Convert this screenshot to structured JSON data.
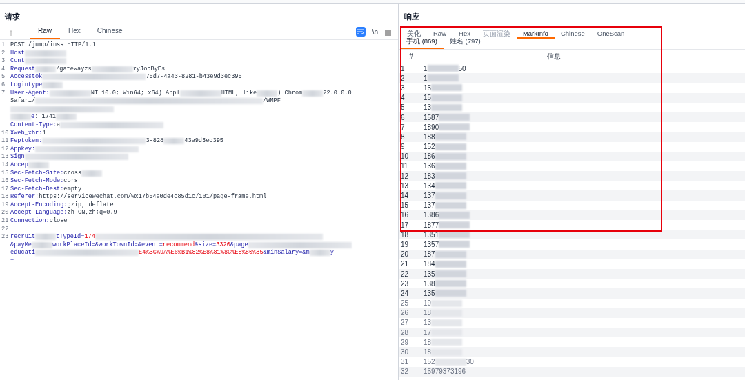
{
  "request": {
    "title": "请求",
    "tabs": [
      {
        "label": "Raw",
        "selected": true
      },
      {
        "label": "Hex",
        "selected": false
      },
      {
        "label": "Chinese",
        "selected": false
      }
    ],
    "toolbar": {
      "newline_label": "\\n",
      "wrap_on": true
    },
    "lines": [
      {
        "n": "1",
        "segments": [
          {
            "kind": "value",
            "t": "POST /jump/inss HTTP/1.1"
          }
        ]
      },
      {
        "n": "2",
        "segments": [
          {
            "kind": "name",
            "t": "Host"
          },
          {
            "kind": "blur_m"
          }
        ]
      },
      {
        "n": "3",
        "segments": [
          {
            "kind": "name",
            "t": "Cont"
          },
          {
            "kind": "blur_m"
          }
        ]
      },
      {
        "n": "4",
        "segments": [
          {
            "kind": "name",
            "t": "Request"
          },
          {
            "kind": "blur_s"
          },
          {
            "kind": "value",
            "t": "/gatewayzs"
          },
          {
            "kind": "blur_m"
          },
          {
            "kind": "value",
            "t": "ryJobByEs"
          }
        ]
      },
      {
        "n": "5",
        "segments": [
          {
            "kind": "name",
            "t": "Accesstok"
          },
          {
            "kind": "blur_l"
          },
          {
            "kind": "value",
            "t": "75d7-4a43-8281-b43e9d3ec395"
          }
        ]
      },
      {
        "n": "6",
        "segments": [
          {
            "kind": "name",
            "t": "Logintype"
          },
          {
            "kind": "blur_s"
          }
        ]
      },
      {
        "n": "7",
        "segments": [
          {
            "kind": "name",
            "t": "User-Agent:"
          },
          {
            "kind": "blur_m"
          },
          {
            "kind": "value",
            "t": "NT 10.0; Win64; x64) Appl"
          },
          {
            "kind": "blur_m"
          },
          {
            "kind": "value",
            "t": "HTML, like"
          },
          {
            "kind": "blur_s"
          },
          {
            "kind": "value",
            "t": ") Chrom"
          },
          {
            "kind": "blur_s"
          },
          {
            "kind": "value",
            "t": "22.0.0.0"
          }
        ]
      },
      {
        "segments": [
          {
            "kind": "value",
            "t": "Safari/"
          },
          {
            "kind": "blur_xl"
          },
          {
            "kind": "value",
            "t": "/WMPF"
          }
        ]
      },
      {
        "segments": [
          {
            "kind": "blur_l"
          }
        ]
      },
      {
        "segments": [
          {
            "kind": "blur_s"
          },
          {
            "kind": "name",
            "t": "e"
          },
          {
            "kind": "value",
            "t": ": 1741"
          },
          {
            "kind": "blur_s"
          }
        ]
      },
      {
        "segments": [
          {
            "kind": "name",
            "t": "Content-Type:"
          },
          {
            "kind": "value",
            "t": " a"
          },
          {
            "kind": "blur_l"
          }
        ]
      },
      {
        "n": "10",
        "segments": [
          {
            "kind": "name",
            "t": "Xweb_xhr:"
          },
          {
            "kind": "value",
            "t": " 1"
          }
        ]
      },
      {
        "n": "11",
        "segments": [
          {
            "kind": "name",
            "t": "Feptoken:"
          },
          {
            "kind": "blur_l"
          },
          {
            "kind": "value",
            "t": "3-828"
          },
          {
            "kind": "blur_s"
          },
          {
            "kind": "value",
            "t": "43e9d3ec395"
          }
        ]
      },
      {
        "n": "12",
        "segments": [
          {
            "kind": "name",
            "t": "Appkey:"
          },
          {
            "kind": "blur_l"
          }
        ]
      },
      {
        "n": "13",
        "segments": [
          {
            "kind": "name",
            "t": "Sign"
          },
          {
            "kind": "blur_l"
          }
        ]
      },
      {
        "n": "14",
        "segments": [
          {
            "kind": "name",
            "t": "Accep"
          },
          {
            "kind": "blur_s"
          }
        ]
      },
      {
        "n": "15",
        "segments": [
          {
            "kind": "name",
            "t": "Sec-Fetch-Site:"
          },
          {
            "kind": "value",
            "t": " cross"
          },
          {
            "kind": "blur_s"
          }
        ]
      },
      {
        "n": "16",
        "segments": [
          {
            "kind": "name",
            "t": "Sec-Fetch-Mode:"
          },
          {
            "kind": "value",
            "t": " cors"
          }
        ]
      },
      {
        "n": "17",
        "segments": [
          {
            "kind": "name",
            "t": "Sec-Fetch-Dest:"
          },
          {
            "kind": "value",
            "t": " empty"
          }
        ]
      },
      {
        "n": "18",
        "segments": [
          {
            "kind": "name",
            "t": "Referer:"
          },
          {
            "kind": "value",
            "t": " https://servicewechat.com/wx17b54e0de4c85d1c/101/page-frame.html"
          }
        ]
      },
      {
        "n": "19",
        "segments": [
          {
            "kind": "name",
            "t": "Accept-Encoding:"
          },
          {
            "kind": "value",
            "t": " gzip, deflate"
          }
        ]
      },
      {
        "n": "20",
        "segments": [
          {
            "kind": "name",
            "t": "Accept-Language:"
          },
          {
            "kind": "value",
            "t": " zh-CN,zh;q=0.9"
          }
        ]
      },
      {
        "n": "21",
        "segments": [
          {
            "kind": "name",
            "t": "Connection:"
          },
          {
            "kind": "value",
            "t": " close"
          }
        ]
      },
      {
        "n": "22"
      },
      {
        "n": "23",
        "segments": [
          {
            "kind": "name",
            "t": "recruit"
          },
          {
            "kind": "blur_s"
          },
          {
            "kind": "name",
            "t": "tTypeId="
          },
          {
            "kind": "param",
            "t": "174"
          },
          {
            "kind": "blur_xl"
          }
        ]
      },
      {
        "segments": [
          {
            "kind": "name",
            "t": "&payMe"
          },
          {
            "kind": "blur_s"
          },
          {
            "kind": "name",
            "t": "workPlaceId=&workTownId=&event="
          },
          {
            "kind": "param",
            "t": "recommend"
          },
          {
            "kind": "name",
            "t": "&size="
          },
          {
            "kind": "param",
            "t": "3320"
          },
          {
            "kind": "name",
            "t": "&page"
          },
          {
            "kind": "blur_l"
          }
        ]
      },
      {
        "segments": [
          {
            "kind": "name",
            "t": "educati"
          },
          {
            "kind": "blur_l"
          },
          {
            "kind": "param",
            "t": "E4%BC%9A%E6%B1%82%E8%81%8C%E8%80%85"
          },
          {
            "kind": "name",
            "t": "&minSalary=&m"
          },
          {
            "kind": "blur_s"
          },
          {
            "kind": "name",
            "t": "y"
          }
        ]
      },
      {
        "segments": [
          {
            "kind": "name",
            "t": "="
          }
        ]
      }
    ]
  },
  "response": {
    "title": "响应",
    "tabs": [
      {
        "label": "美化",
        "selected": false,
        "disabled": false
      },
      {
        "label": "Raw",
        "selected": false,
        "disabled": false
      },
      {
        "label": "Hex",
        "selected": false,
        "disabled": false
      },
      {
        "label": "页面渲染",
        "selected": false,
        "disabled": true
      },
      {
        "label": "MarkInfo",
        "selected": true,
        "disabled": false
      },
      {
        "label": "Chinese",
        "selected": false,
        "disabled": false
      },
      {
        "label": "OneScan",
        "selected": false,
        "disabled": false
      }
    ],
    "subtabs": [
      {
        "label": "手机 (869)",
        "selected": true
      },
      {
        "label": "姓名 (797)",
        "selected": false
      }
    ],
    "table": {
      "columns": [
        "#",
        "信息"
      ],
      "rows": [
        {
          "n": "1",
          "v": "1",
          "tail": "50",
          "faded": false
        },
        {
          "n": "2",
          "v": "1",
          "faded": false
        },
        {
          "n": "3",
          "v": "15",
          "faded": false
        },
        {
          "n": "4",
          "v": "15",
          "faded": false
        },
        {
          "n": "5",
          "v": "13",
          "faded": false
        },
        {
          "n": "6",
          "v": "1587",
          "faded": false
        },
        {
          "n": "7",
          "v": "1890",
          "faded": false
        },
        {
          "n": "8",
          "v": "188",
          "faded": false
        },
        {
          "n": "9",
          "v": "152",
          "faded": false
        },
        {
          "n": "10",
          "v": "186",
          "faded": false
        },
        {
          "n": "11",
          "v": "136",
          "faded": false
        },
        {
          "n": "12",
          "v": "183",
          "faded": false
        },
        {
          "n": "13",
          "v": "134",
          "faded": false
        },
        {
          "n": "14",
          "v": "137",
          "faded": false
        },
        {
          "n": "15",
          "v": "137",
          "faded": false
        },
        {
          "n": "16",
          "v": "1386",
          "faded": false
        },
        {
          "n": "17",
          "v": "1877",
          "faded": false
        },
        {
          "n": "18",
          "v": "1351",
          "faded": false
        },
        {
          "n": "19",
          "v": "1357",
          "faded": false
        },
        {
          "n": "20",
          "v": "187",
          "faded": false
        },
        {
          "n": "21",
          "v": "184",
          "faded": false
        },
        {
          "n": "22",
          "v": "135",
          "faded": false
        },
        {
          "n": "23",
          "v": "138",
          "faded": false
        },
        {
          "n": "24",
          "v": "135",
          "faded": false
        },
        {
          "n": "25",
          "v": "19",
          "faded": true
        },
        {
          "n": "26",
          "v": "18",
          "faded": true
        },
        {
          "n": "27",
          "v": "13",
          "faded": true
        },
        {
          "n": "28",
          "v": "17",
          "faded": true
        },
        {
          "n": "29",
          "v": "18",
          "faded": true
        },
        {
          "n": "30",
          "v": "18",
          "faded": true
        },
        {
          "n": "31",
          "v": "152",
          "tail": "30",
          "faded": true
        },
        {
          "n": "32",
          "v": "15979373196",
          "faded": true
        }
      ]
    }
  }
}
